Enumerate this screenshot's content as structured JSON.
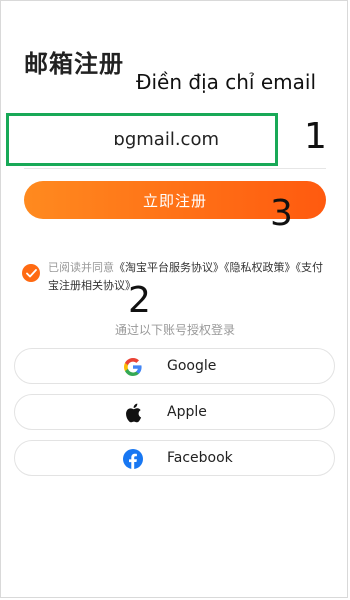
{
  "header": {
    "title": "邮箱注册"
  },
  "annotations": {
    "instruction": "Điền địa chỉ email",
    "step1": "1",
    "step2": "2",
    "step3": "3",
    "highlight_color": "#18a957"
  },
  "form": {
    "email_value": "ɒgmail.com",
    "register_label": "立即注册"
  },
  "agreement": {
    "prefix": "已阅读并同意",
    "links": [
      "《淘宝平台服务协议》",
      "《隐私权政策》",
      "《支付宝注册相关协议》"
    ],
    "checked": true
  },
  "social": {
    "heading": "通过以下账号授权登录",
    "providers": [
      {
        "label": "Google",
        "icon": "google-icon"
      },
      {
        "label": "Apple",
        "icon": "apple-icon"
      },
      {
        "label": "Facebook",
        "icon": "facebook-icon"
      }
    ]
  },
  "colors": {
    "accent": "#ff6a12",
    "accent_gradient_start": "#ff8a1f",
    "facebook": "#1877f2"
  }
}
